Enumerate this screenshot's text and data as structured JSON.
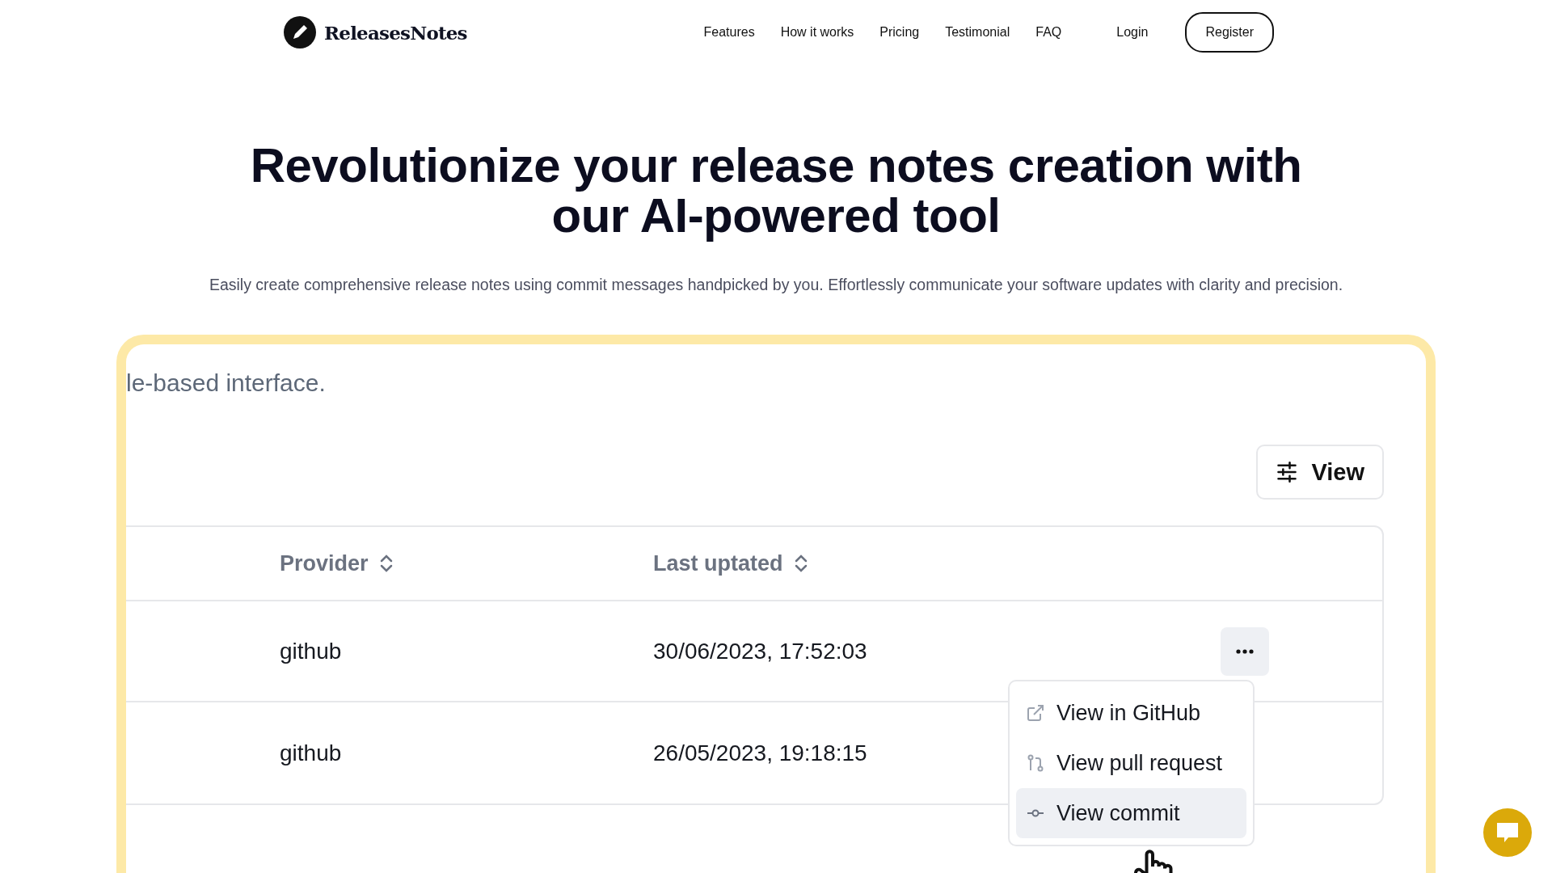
{
  "nav": {
    "brand": "ReleasesNotes",
    "links": [
      {
        "label": "Features"
      },
      {
        "label": "How it works"
      },
      {
        "label": "Pricing"
      },
      {
        "label": "Testimonial"
      },
      {
        "label": "FAQ"
      }
    ],
    "login": "Login",
    "register": "Register"
  },
  "hero": {
    "title": "Revolutionize your release notes creation with our AI-powered tool",
    "subtitle": "Easily create comprehensive release notes using commit messages handpicked by you. Effortlessly communicate your software updates with clarity and precision."
  },
  "showcase": {
    "caption": "le-based interface.",
    "view_button": "View",
    "table": {
      "columns": [
        "Provider",
        "Last uptated"
      ],
      "rows": [
        {
          "provider": "github",
          "last_updated": "30/06/2023, 17:52:03",
          "menu_open": true
        },
        {
          "provider": "github",
          "last_updated": "26/05/2023, 19:18:15",
          "menu_open": false
        }
      ]
    },
    "menu": [
      {
        "label": "View in GitHub",
        "kind": "external",
        "selected": false
      },
      {
        "label": "View pull request",
        "kind": "pull",
        "selected": false
      },
      {
        "label": "View commit",
        "kind": "commit",
        "selected": true
      }
    ]
  }
}
